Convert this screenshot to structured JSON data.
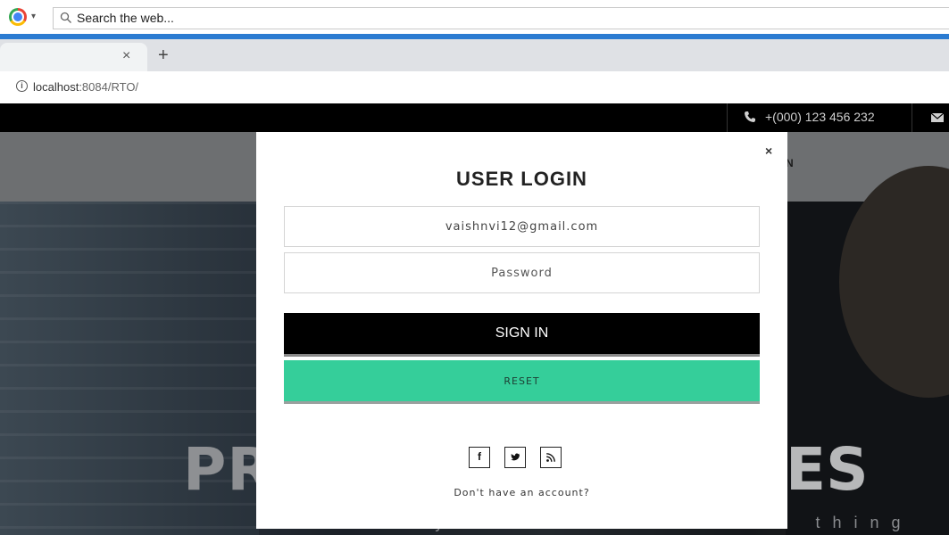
{
  "browser": {
    "search_placeholder": "Search the web...",
    "url_host": "localhost",
    "url_rest": ":8084/RTO/",
    "tab_close": "×",
    "new_tab": "+",
    "accent_color": "#2b7bd1"
  },
  "site": {
    "phone": "+(000) 123 456 232",
    "nav_peek": "N",
    "hero_title_left": "PR",
    "hero_title_right": "ES",
    "hero_subtitle": "You only have to know one thing"
  },
  "modal": {
    "close": "×",
    "title": "USER LOGIN",
    "email_value": "vaishnvi12@gmail.com",
    "password_placeholder": "Password",
    "signin_label": "SIGN IN",
    "reset_label": "RESET",
    "social": {
      "facebook": "f",
      "twitter": "🐦",
      "rss": "⌇"
    },
    "signup_text": "Don't have an account?",
    "reset_color": "#35ce9a"
  }
}
